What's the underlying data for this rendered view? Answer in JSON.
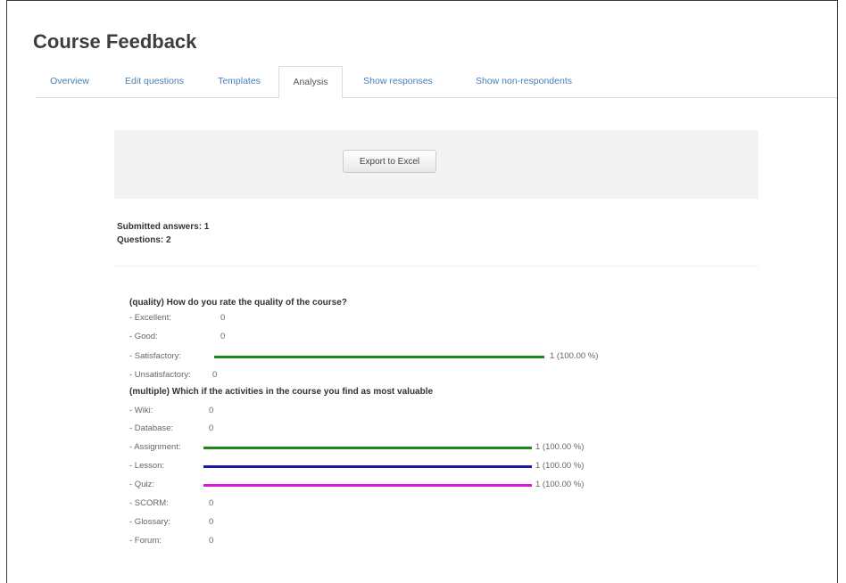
{
  "page": {
    "title": "Course Feedback"
  },
  "tabs": [
    {
      "label": "Overview",
      "active": false
    },
    {
      "label": "Edit questions",
      "active": false
    },
    {
      "label": "Templates",
      "active": false
    },
    {
      "label": "Analysis",
      "active": true
    },
    {
      "label": "Show responses",
      "active": false
    },
    {
      "label": "Show non-respondents",
      "active": false
    }
  ],
  "export": {
    "button_label": "Export to Excel"
  },
  "summary": {
    "submitted": "Submitted answers: 1",
    "questions": "Questions: 2"
  },
  "colors": {
    "bar_green": "#1a8a1a",
    "bar_blue": "#1a1aa8",
    "bar_magenta": "#d91ad9",
    "tab_link": "#4a7fb5"
  },
  "q1": {
    "text": "(quality) How do you rate the quality of the course?",
    "options": [
      {
        "label": "- Excellent:",
        "count": "0",
        "pct": "",
        "fraction": 0
      },
      {
        "label": "- Good:",
        "count": "0",
        "pct": "",
        "fraction": 0
      },
      {
        "label": "- Satisfactory:",
        "count": "",
        "pct": "1 (100.00 %)",
        "fraction": 1,
        "color": "#1a8a1a"
      },
      {
        "label": "- Unsatisfactory:",
        "count": "0",
        "pct": "",
        "fraction": 0
      }
    ]
  },
  "q2": {
    "text": "(multiple) Which if the activities in the course you find as most valuable",
    "options": [
      {
        "label": "- Wiki:",
        "count": "0",
        "pct": "",
        "fraction": 0
      },
      {
        "label": "- Database:",
        "count": "0",
        "pct": "",
        "fraction": 0
      },
      {
        "label": "- Assignment:",
        "count": "",
        "pct": "1 (100.00 %)",
        "fraction": 1,
        "color": "#1a8a1a"
      },
      {
        "label": "- Lesson:",
        "count": "",
        "pct": "1 (100.00 %)",
        "fraction": 1,
        "color": "#1a1aa8"
      },
      {
        "label": "- Quiz:",
        "count": "",
        "pct": "1 (100.00 %)",
        "fraction": 1,
        "color": "#d91ad9"
      },
      {
        "label": "- SCORM:",
        "count": "0",
        "pct": "",
        "fraction": 0
      },
      {
        "label": "- Glossary:",
        "count": "0",
        "pct": "",
        "fraction": 0
      },
      {
        "label": "- Forum:",
        "count": "0",
        "pct": "",
        "fraction": 0
      }
    ]
  }
}
